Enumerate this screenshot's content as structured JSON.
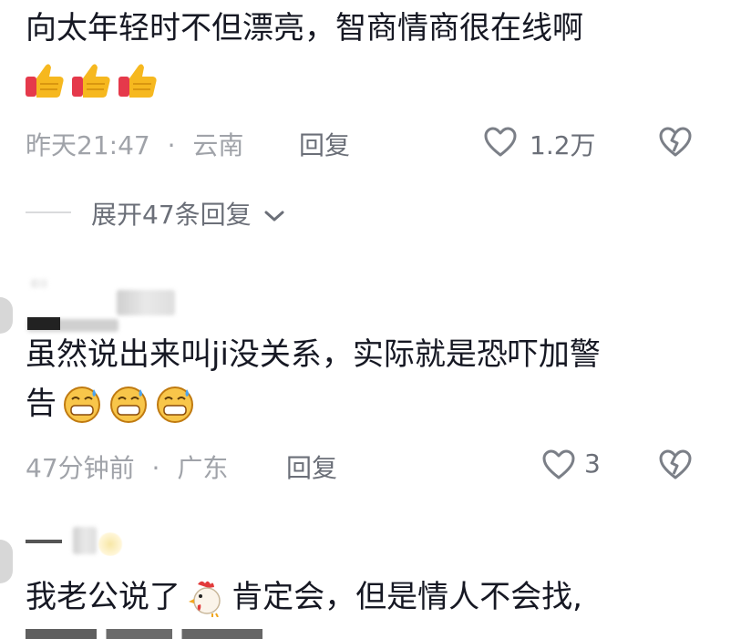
{
  "colors": {
    "text": "#161823",
    "meta": "#a0a3a9",
    "secondary": "#6b6f78",
    "divider": "#d9dadc"
  },
  "comments": [
    {
      "text_line1": "向太年轻时不但漂亮，智商情商很在线啊",
      "emoji": [
        "thumbs-up",
        "thumbs-up",
        "thumbs-up"
      ],
      "time": "昨天21:47",
      "separator": "·",
      "location": "云南",
      "reply_label": "回复",
      "like_count": "1.2万",
      "expand_label": "展开47条回复"
    },
    {
      "text_line1": "虽然说出来叫ji没关系，实际就是恐吓加警",
      "text_line2": "告",
      "emoji": [
        "grinning-sweat",
        "grinning-sweat",
        "grinning-sweat"
      ],
      "time": "47分钟前",
      "separator": "·",
      "location": "广东",
      "reply_label": "回复",
      "like_count": "3"
    },
    {
      "text_line1_a": "我老公说了",
      "emoji_inline": "rooster",
      "text_line1_b": "肯定会，但是情人不会找,"
    }
  ],
  "icons": {
    "like": "heart-outline-icon",
    "dislike": "broken-heart-icon",
    "expand": "chevron-down-icon"
  }
}
